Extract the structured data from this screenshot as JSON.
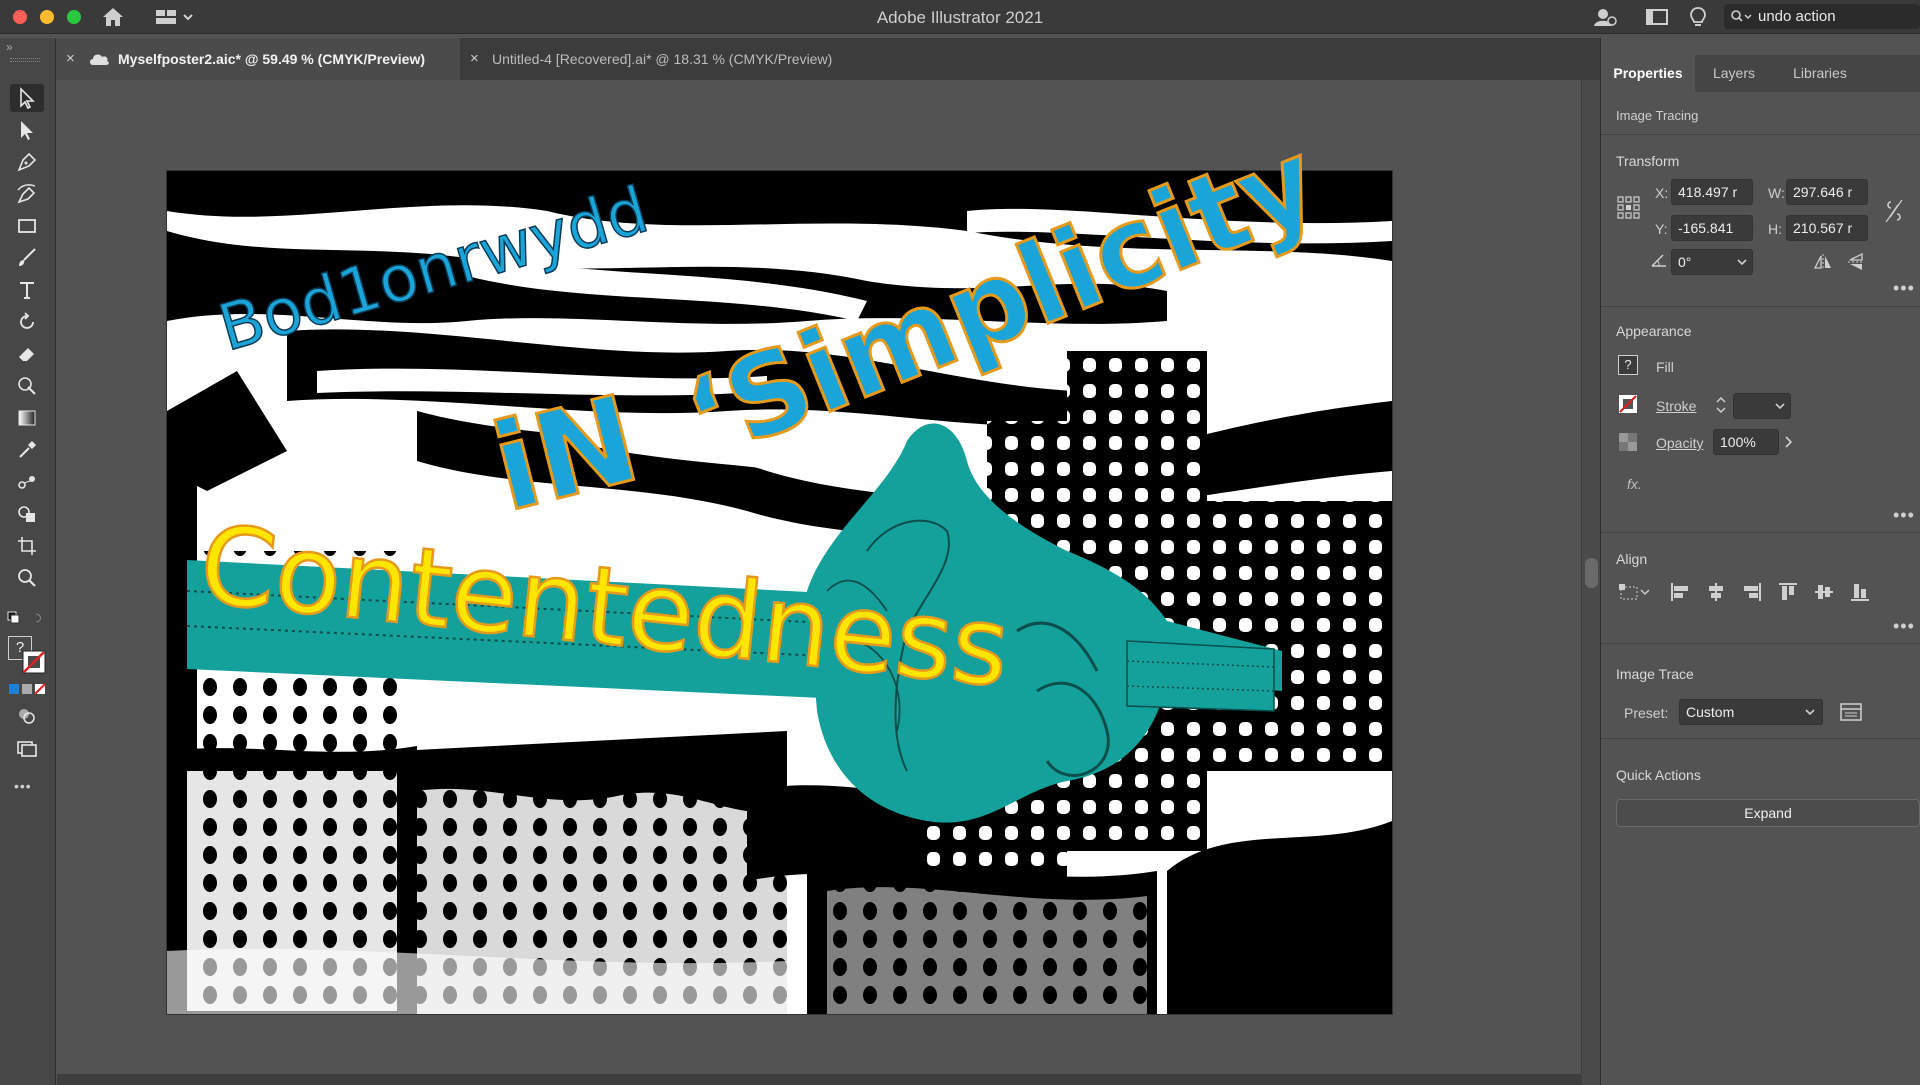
{
  "window": {
    "title": "Adobe Illustrator 2021",
    "search_value": "undo action"
  },
  "tabs": [
    {
      "label": "Myselfposter2.aic* @ 59.49 % (CMYK/Preview)",
      "close": "×",
      "active": true
    },
    {
      "label": "Untitled-4 [Recovered].ai* @ 18.31 % (CMYK/Preview)",
      "close": "×",
      "active": false
    }
  ],
  "tools": [
    {
      "name": "selection-tool",
      "icon": "arrow-icon"
    },
    {
      "name": "direct-selection-tool",
      "icon": "direct-arrow-icon"
    },
    {
      "name": "pen-tool",
      "icon": "pen-icon"
    },
    {
      "name": "curvature-tool",
      "icon": "curvature-icon"
    },
    {
      "name": "rectangle-tool",
      "icon": "rectangle-icon"
    },
    {
      "name": "paintbrush-tool",
      "icon": "brush-icon"
    },
    {
      "name": "type-tool",
      "icon": "type-icon"
    },
    {
      "name": "rotate-tool",
      "icon": "rotate-icon"
    },
    {
      "name": "eraser-tool",
      "icon": "eraser-icon"
    },
    {
      "name": "warp-tool",
      "icon": "warp-icon"
    },
    {
      "name": "gradient-tool",
      "icon": "gradient-icon"
    },
    {
      "name": "eyedropper-tool",
      "icon": "eyedropper-icon"
    },
    {
      "name": "blend-tool",
      "icon": "blend-icon"
    },
    {
      "name": "shape-builder-tool",
      "icon": "shape-builder-icon"
    },
    {
      "name": "artboard-tool",
      "icon": "artboard-icon"
    },
    {
      "name": "zoom-tool",
      "icon": "zoom-icon"
    }
  ],
  "toolbar_misc": {
    "fill_question": "?",
    "more": "•••"
  },
  "artwork": {
    "text_bod": "Bod1onrwydd",
    "text_in": "iN",
    "text_simplicity": "‘Simplicity",
    "text_contentedness": "Contentedness",
    "colors": {
      "teal": "#14a19b",
      "blue": "#1ba4d8",
      "yellow": "#ffe600",
      "orange": "#e59a1c",
      "black": "#000000"
    }
  },
  "properties_panel": {
    "tabs": [
      "Properties",
      "Layers",
      "Libraries"
    ],
    "selection_type": "Image Tracing",
    "transform": {
      "title": "Transform",
      "x_label": "X:",
      "x": "418.497 r",
      "y_label": "Y:",
      "y": "-165.841",
      "w_label": "W:",
      "w": "297.646 r",
      "h_label": "H:",
      "h": "210.567 r",
      "angle": "0°"
    },
    "appearance": {
      "title": "Appearance",
      "fill_label": "Fill",
      "fill_swatch": "?",
      "stroke_label": "Stroke",
      "opacity_label": "Opacity",
      "opacity": "100%",
      "fx": "fx."
    },
    "align": {
      "title": "Align"
    },
    "image_trace": {
      "title": "Image Trace",
      "preset_label": "Preset:",
      "preset": "Custom"
    },
    "quick_actions": {
      "title": "Quick Actions",
      "expand_label": "Expand"
    },
    "more": "•••"
  }
}
